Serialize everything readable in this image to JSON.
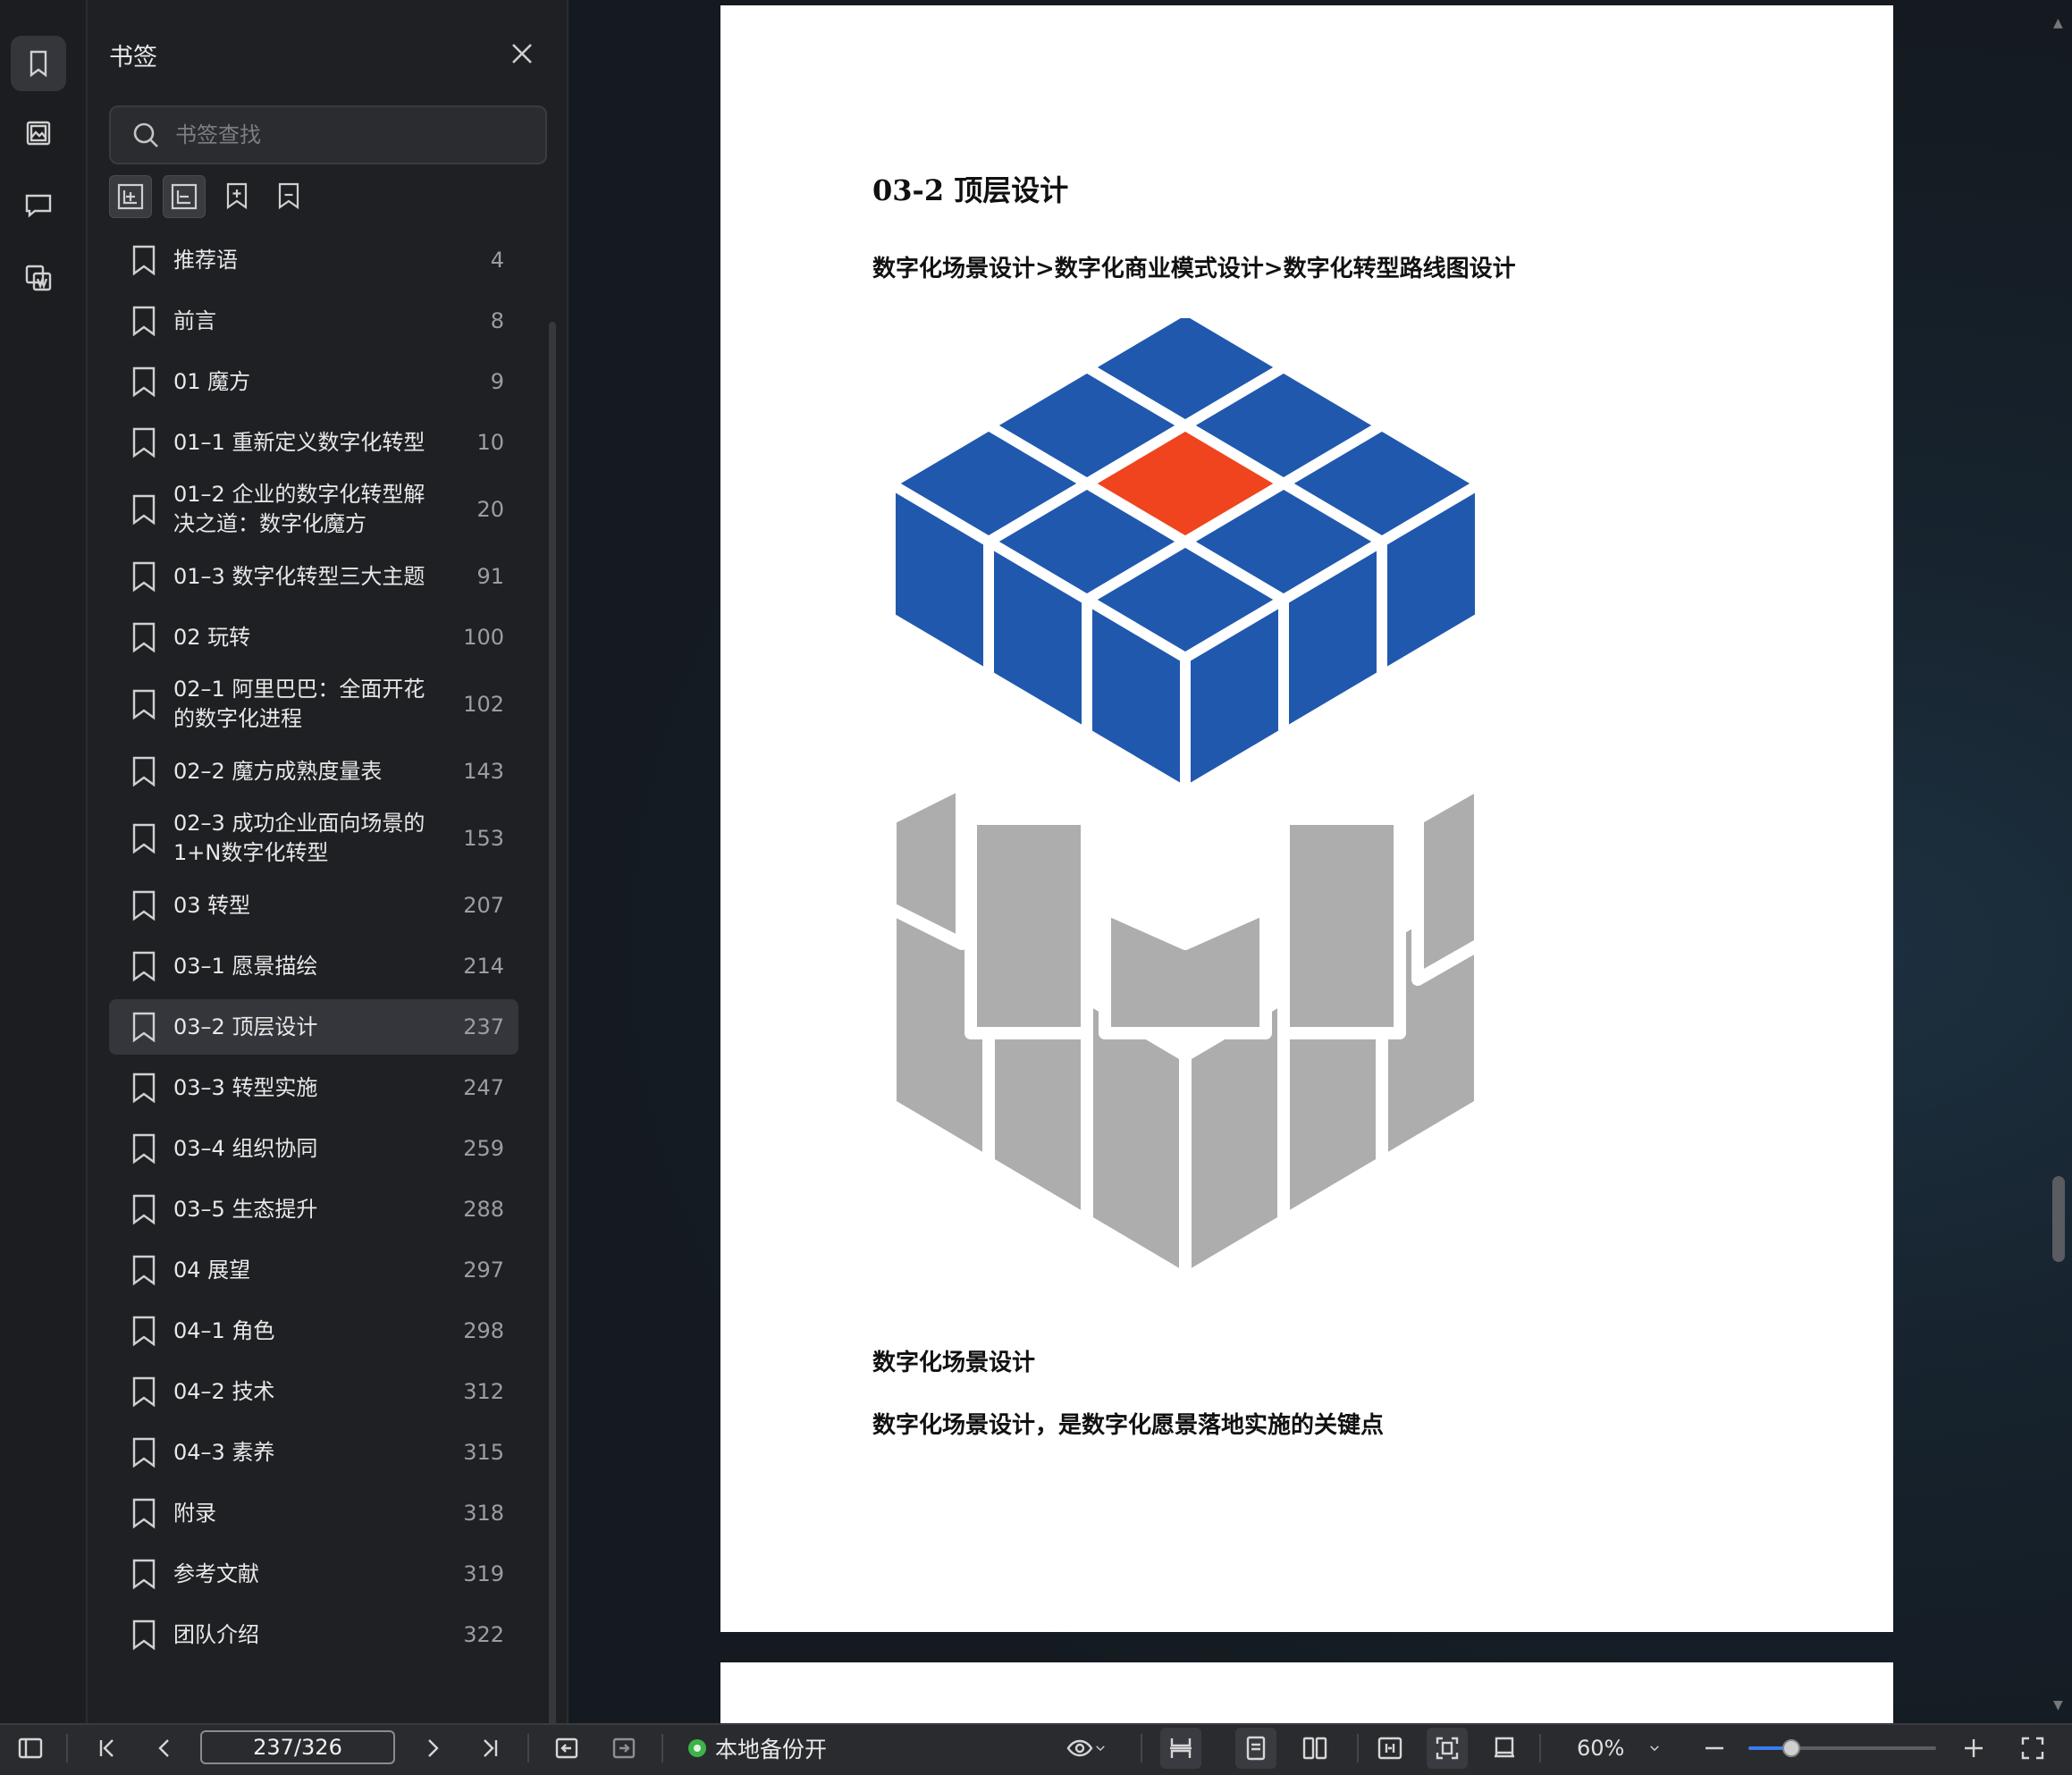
{
  "sidebar_rail": {
    "items": [
      {
        "icon": "bookmark-icon",
        "active": true
      },
      {
        "icon": "image-icon",
        "active": false
      },
      {
        "icon": "comment-icon",
        "active": false
      },
      {
        "icon": "extract-icon",
        "active": false
      }
    ]
  },
  "bookmark_panel": {
    "title": "书签",
    "search_placeholder": "书签查找",
    "items": [
      {
        "label": "推荐语",
        "page": "4"
      },
      {
        "label": "前言",
        "page": "8"
      },
      {
        "label": "01 魔方",
        "page": "9"
      },
      {
        "label": "01–1 重新定义数字化转型",
        "page": "10"
      },
      {
        "label": "01–2 企业的数字化转型解决之道：数字化魔方",
        "page": "20"
      },
      {
        "label": "01–3 数字化转型三大主题",
        "page": "91"
      },
      {
        "label": "02 玩转",
        "page": "100"
      },
      {
        "label": "02–1 阿里巴巴：全面开花的数字化进程",
        "page": "102"
      },
      {
        "label": "02–2 魔方成熟度量表",
        "page": "143"
      },
      {
        "label": "02–3 成功企业面向场景的1+N数字化转型",
        "page": "153"
      },
      {
        "label": "03 转型",
        "page": "207"
      },
      {
        "label": "03–1 愿景描绘",
        "page": "214"
      },
      {
        "label": "03–2 顶层设计",
        "page": "237",
        "selected": true
      },
      {
        "label": "03–3 转型实施",
        "page": "247"
      },
      {
        "label": "03–4 组织协同",
        "page": "259"
      },
      {
        "label": "03–5 生态提升",
        "page": "288"
      },
      {
        "label": "04 展望",
        "page": "297"
      },
      {
        "label": "04–1 角色",
        "page": "298"
      },
      {
        "label": "04–2 技术",
        "page": "312"
      },
      {
        "label": "04–3 素养",
        "page": "315"
      },
      {
        "label": "附录",
        "page": "318"
      },
      {
        "label": "参考文献",
        "page": "319"
      },
      {
        "label": "团队介绍",
        "page": "322"
      }
    ]
  },
  "document": {
    "heading": "03-2 顶层设计",
    "subheading": "数字化场景设计>数字化商业模式设计>数字化转型路线图设计",
    "section_title": "数字化场景设计",
    "paragraph": "数字化场景设计，是数字化愿景落地实施的关键点",
    "cube_colors": {
      "blue": "#2058ae",
      "red": "#ef441e",
      "gray": "#adadad"
    }
  },
  "status_bar": {
    "page_indicator": "237/326",
    "backup_label": "本地备份开",
    "zoom_label": "60%",
    "zoom_fraction": 0.23
  }
}
